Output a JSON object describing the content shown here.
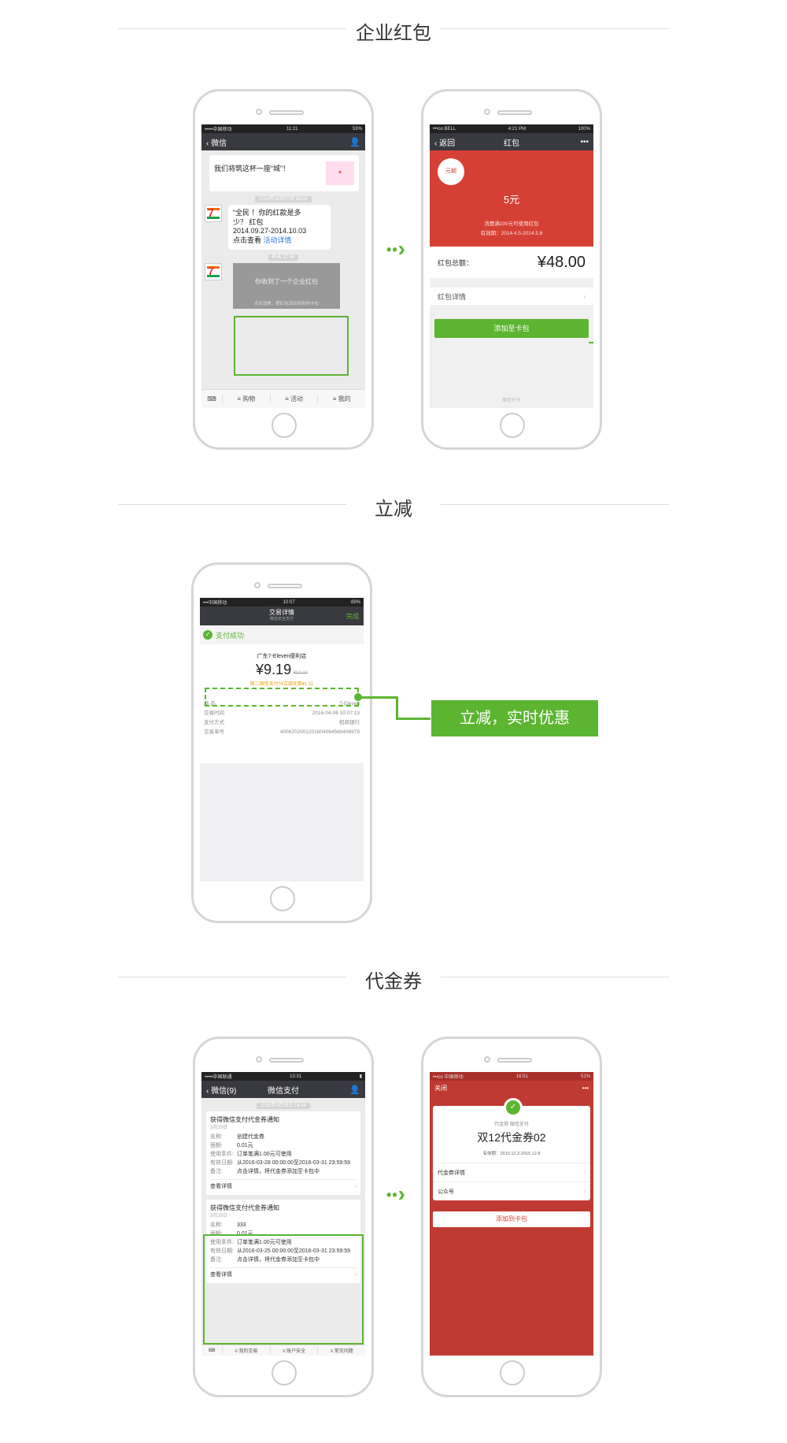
{
  "sections": {
    "redpacket_title": "企业红包",
    "discount_title": "立减",
    "coupon_title": "代金券"
  },
  "phone1": {
    "status": {
      "carrier": "•••••中国移动",
      "time": "11:21",
      "battery": "53%"
    },
    "nav": {
      "back": "微信"
    },
    "msg1": "我们将筑这杯一座“城”！",
    "time1": "2014年10月07日 18:00",
    "msg2_line1": "“全民    ！你的红款是多",
    "msg2_line2": "少？  红包",
    "msg2_line3": "2014.09.27-2014.10.03",
    "msg2_line4": "点击查看",
    "msg2_link": "活动详情",
    "time2": "昨天 17:55",
    "redpacket_text": "你收到了一个企业红包",
    "redpacket_sub": "点击消费，把红包添加到你的卡包",
    "menu": {
      "shop": "购物",
      "activity": "活动",
      "mine": "我的"
    }
  },
  "phone2": {
    "status": {
      "carrier": "•••oo BELL",
      "time": "4:21 PM",
      "battery": "100%"
    },
    "nav": {
      "back": "返回",
      "title": "红包",
      "more": "•••"
    },
    "logo_text": "元朝",
    "amount_label": "5元",
    "condition": "消费满100元可使用红包",
    "validity": "有效期：2014.4.5-2014.5.8",
    "total_label": "红包总额：",
    "total_value": "¥48.00",
    "detail_label": "红包详情",
    "add_button": "添加至卡包",
    "footer": "微信打卡"
  },
  "phone3": {
    "status": {
      "carrier": "•••中国移动",
      "time": "10:07",
      "battery": "89%"
    },
    "nav": {
      "title": "交易详情",
      "subtitle": "微信安全支付",
      "done": "完成"
    },
    "paid": "支付成功",
    "store": "广东7-Eleven便利店",
    "price": "¥9.19",
    "original": "¥10.20",
    "discount_note": "周二微信支付分立减优惠¥1.11",
    "rows": [
      {
        "k": "商   品",
        "v": "7-Eleven"
      },
      {
        "k": "交易时间",
        "v": "2016-04-06 10:07:13"
      },
      {
        "k": "支付方式",
        "v": "招商银行"
      },
      {
        "k": "交易单号",
        "v": "4006202001201604064560406979"
      }
    ]
  },
  "callout": "立减，实时优惠",
  "phone4": {
    "status": {
      "carrier": "•••••中国联通",
      "time": "13:31",
      "battery": ""
    },
    "nav": {
      "back": "微信(9)",
      "title": "微信支付"
    },
    "time": "2016年3月29日 14:54",
    "cards": [
      {
        "title": "获得微信支付代金券通知",
        "date": "3月29日",
        "name_k": "名称:",
        "name_v": "创建代金券",
        "amt_k": "面额:",
        "amt_v": "0.01元",
        "cond_k": "使用条件:",
        "cond_v": "订单笔满1.00元可使用",
        "valid_k": "有效日期:",
        "valid_v": "从2016-03-28 00:00:00至2016-03-31 23:59:59",
        "note_k": "备注:",
        "note_v": "点击详情，将代金券添加至卡包中",
        "more": "查看详情"
      },
      {
        "title": "获得微信支付代金券通知",
        "date": "3月29日",
        "name_k": "名称:",
        "name_v": "333",
        "amt_k": "面额:",
        "amt_v": "0.01元",
        "cond_k": "使用条件:",
        "cond_v": "订单笔满1.00元可使用",
        "valid_k": "有效日期:",
        "valid_v": "从2016-03-25 00:00:00至2016-03-31 23:59:59",
        "note_k": "备注:",
        "note_v": "点击详情，将代金券添加至卡包中",
        "more": "查看详情"
      }
    ],
    "menu": {
      "trade": "我的交易",
      "security": "账户安全",
      "faq": "常见问题"
    }
  },
  "phone5": {
    "status": {
      "carrier": "•••oo 中国移动",
      "time": "16:51",
      "battery": "51%"
    },
    "nav": {
      "close": "关闭",
      "more": "•••"
    },
    "brand": "代金券 微信支付",
    "title": "双12代金券02",
    "validity": "有效期：2015.12.2-2015.12.8",
    "detail": "代金券详情",
    "official": "公众号",
    "add_button": "添加到卡包"
  },
  "colors": {
    "green": "#5cb531",
    "red": "#d64034",
    "coupon_red": "#bf3a32",
    "nav_dark": "#393a3f"
  }
}
